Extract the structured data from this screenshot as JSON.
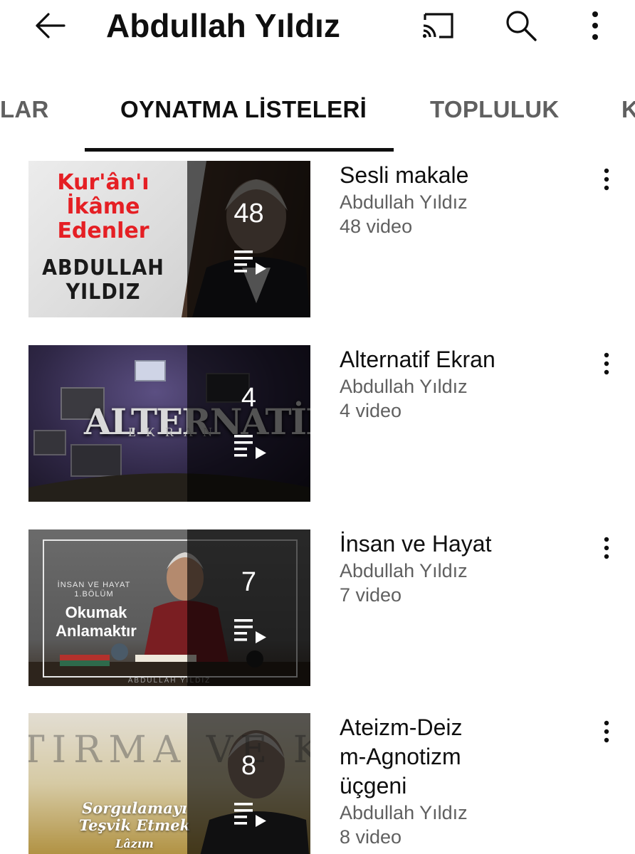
{
  "header": {
    "title": "Abdullah Yıldız",
    "icons": [
      "back-arrow-icon",
      "cast-icon",
      "search-icon",
      "more-vert-icon"
    ]
  },
  "tabs": [
    {
      "label": "OLAR",
      "active": false
    },
    {
      "label": "OYNATMA LİSTELERİ",
      "active": true
    },
    {
      "label": "TOPLULUK",
      "active": false
    },
    {
      "label": "K",
      "active": false
    }
  ],
  "playlists": [
    {
      "title": "Sesli makale",
      "channel": "Abdullah Yıldız",
      "video_count_label": "48 video",
      "count": "48",
      "thumb_text": [
        "Kur'ân'ı",
        "İkâme",
        "Edenler",
        "ABDULLAH",
        "YILDIZ"
      ]
    },
    {
      "title": "Alternatif Ekran",
      "channel": "Abdullah Yıldız",
      "video_count_label": "4 video",
      "count": "4",
      "thumb_text": [
        "ALTERNATİF",
        "EKRAN"
      ]
    },
    {
      "title": "İnsan ve Hayat",
      "channel": "Abdullah Yıldız",
      "video_count_label": "7 video",
      "count": "7",
      "thumb_text": [
        "İNSAN VE HAYAT",
        "1.BÖLÜM",
        "Okumak",
        "Anlamaktır",
        "ABDULLAH YILDIZ"
      ]
    },
    {
      "title": "Ateizm-Deizm-Agnotizm üçgeni",
      "title_lines": [
        "Ateizm-Deiz",
        "m-Agnotizm",
        "üçgeni"
      ],
      "channel": "Abdullah Yıldız",
      "video_count_label": "8 video",
      "count": "8",
      "thumb_text": [
        "TIRMA VE KULT",
        "Sorgulamayı",
        "Teşvik Etmek",
        "Lâzım"
      ]
    }
  ],
  "colors": {
    "text_primary": "#0f0f0f",
    "text_secondary": "#606060",
    "overlay": "#000000"
  }
}
